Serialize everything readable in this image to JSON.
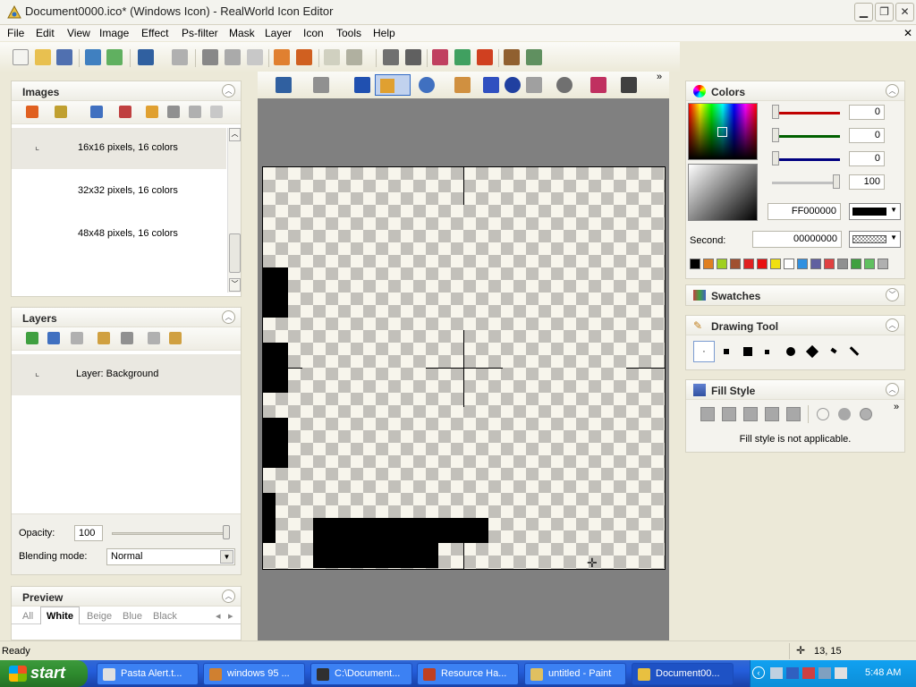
{
  "window": {
    "title": "Document0000.ico* (Windows Icon) - RealWorld Icon Editor"
  },
  "menu": [
    "File",
    "Edit",
    "View",
    "Image",
    "Effect",
    "Ps-filter",
    "Mask",
    "Layer",
    "Icon",
    "Tools",
    "Help"
  ],
  "images_panel": {
    "title": "Images",
    "items": [
      {
        "label": "16x16 pixels, 16 colors",
        "selected": true
      },
      {
        "label": "32x32 pixels, 16 colors",
        "selected": false
      },
      {
        "label": "48x48 pixels, 16 colors",
        "selected": false
      }
    ]
  },
  "layers_panel": {
    "title": "Layers",
    "items": [
      {
        "label": "Layer: Background"
      }
    ],
    "opacity_label": "Opacity:",
    "opacity_value": "100",
    "blending_label": "Blending mode:",
    "blending_value": "Normal"
  },
  "preview_panel": {
    "title": "Preview",
    "tabs": [
      "All",
      "White",
      "Beige",
      "Blue",
      "Black"
    ],
    "active_tab": "White"
  },
  "colors_panel": {
    "title": "Colors",
    "channels": [
      "0",
      "0",
      "0",
      "100"
    ],
    "primary_hex": "FF000000",
    "second_label": "Second:",
    "second_hex": "00000000",
    "palette": [
      "#000000",
      "#E08020",
      "#A0D020",
      "#A05030",
      "#E02020",
      "#E81010",
      "#F0E010",
      "#FFFFFF",
      "#3090E0",
      "#6060A0",
      "#E04040",
      "#909090",
      "#40A040",
      "#60C060",
      "#B0B0B0"
    ]
  },
  "swatches_panel": {
    "title": "Swatches"
  },
  "drawing_tool_panel": {
    "title": "Drawing Tool"
  },
  "fill_style_panel": {
    "title": "Fill Style",
    "message": "Fill style is not applicable."
  },
  "status": {
    "text": "Ready",
    "coords": "13, 15"
  },
  "taskbar": {
    "start_label": "start",
    "tasks": [
      {
        "label": "Pasta Alert.t...",
        "active": false
      },
      {
        "label": "windows 95 ...",
        "active": false
      },
      {
        "label": "C:\\Document...",
        "active": false
      },
      {
        "label": "Resource Ha...",
        "active": false
      },
      {
        "label": "untitled - Paint",
        "active": false
      },
      {
        "label": "Document00...",
        "active": true
      }
    ],
    "clock": "5:48 AM"
  }
}
